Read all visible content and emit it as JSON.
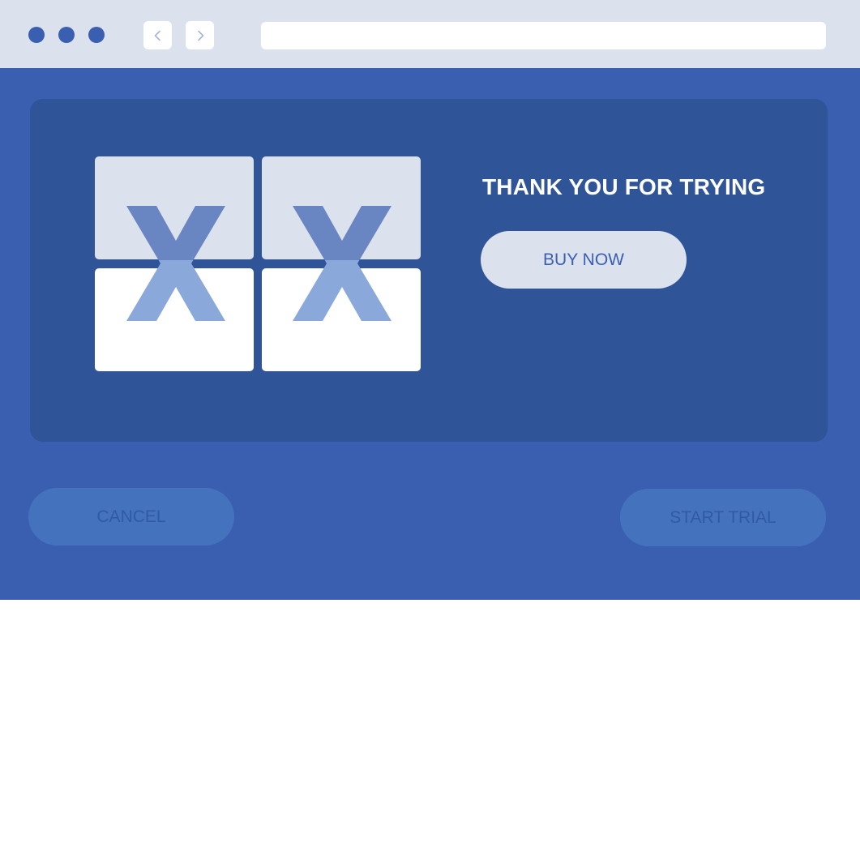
{
  "colors": {
    "chrome_bg": "#dce1ee",
    "dot": "#3a5fb0",
    "nav_icon": "#a9b6d3",
    "viewport_bg": "#3a5fb0",
    "card_bg": "#305498",
    "tile_light": "#dce1ee",
    "tile_white": "#ffffff",
    "x_top": "#6a86c2",
    "x_bottom": "#8aa9da",
    "headline_text": "#ffffff",
    "buy_now_bg": "#dce1ee",
    "buy_now_text": "#3a5fb0",
    "secondary_btn_bg": "#4572bd",
    "secondary_btn_text": "#3159a6"
  },
  "browser": {
    "window_controls": [
      "dot",
      "dot",
      "dot"
    ],
    "back_icon": "chevron-left-icon",
    "forward_icon": "chevron-right-icon",
    "address_value": ""
  },
  "main": {
    "headline": "THANK YOU FOR TRYING",
    "buy_now_label": "BUY NOW",
    "illustration": {
      "marks": [
        "X",
        "X"
      ]
    }
  },
  "footer": {
    "cancel_label": "CANCEL",
    "start_trial_label": "START TRIAL"
  }
}
